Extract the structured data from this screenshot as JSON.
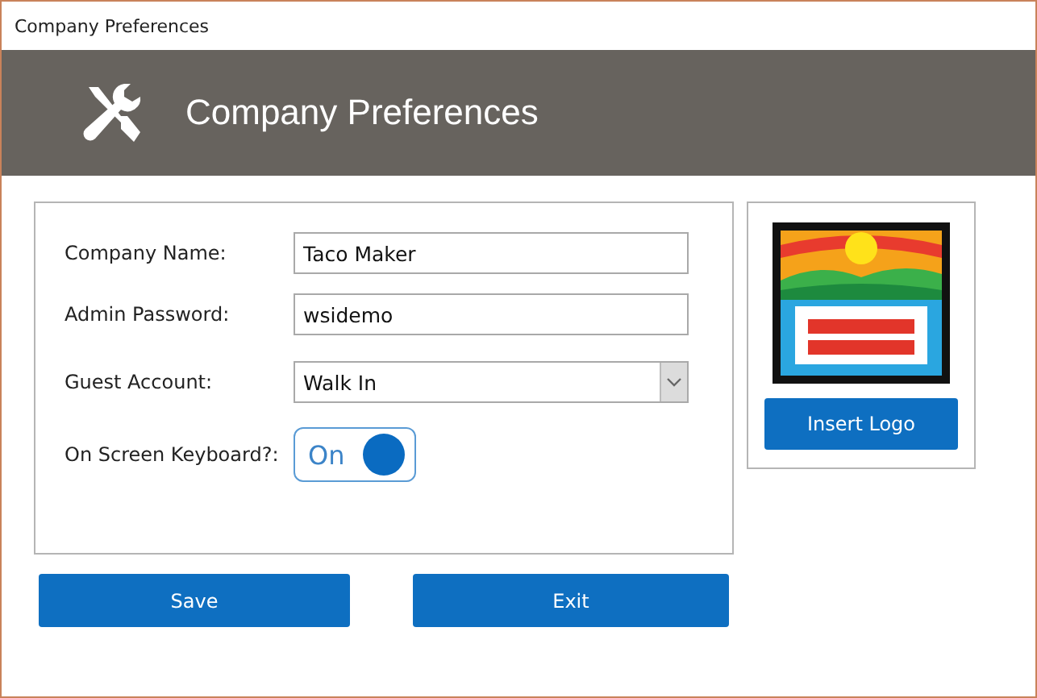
{
  "window": {
    "title": "Company Preferences"
  },
  "header": {
    "title": "Company Preferences"
  },
  "form": {
    "fields": [
      {
        "kind": "text",
        "label": "Company Name:",
        "value": "Taco Maker"
      },
      {
        "kind": "text",
        "label": "Admin Password:",
        "value": "wsidemo"
      },
      {
        "kind": "dropdown",
        "label": "Guest Account:",
        "value": "Walk In"
      },
      {
        "kind": "toggle",
        "label": "On Screen Keyboard?:",
        "text": "On",
        "on": true
      }
    ]
  },
  "logo": {
    "kind": "picture",
    "button": "Insert Logo"
  },
  "buttons": [
    "Save",
    "Exit"
  ]
}
